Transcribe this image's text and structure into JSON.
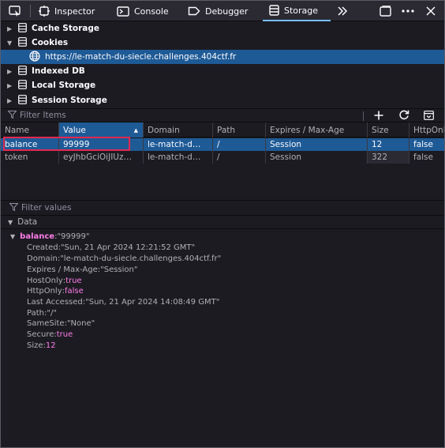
{
  "toolbar": {
    "tabs": [
      {
        "label": "Inspector"
      },
      {
        "label": "Console"
      },
      {
        "label": "Debugger"
      },
      {
        "label": "Storage"
      }
    ]
  },
  "tree": {
    "items": [
      {
        "label": "Cache Storage"
      },
      {
        "label": "Cookies"
      },
      {
        "label": "https://le-match-du-siecle.challenges.404ctf.fr"
      },
      {
        "label": "Indexed DB"
      },
      {
        "label": "Local Storage"
      },
      {
        "label": "Session Storage"
      }
    ]
  },
  "filter_items": {
    "placeholder": "Filter Items"
  },
  "table": {
    "columns": [
      "Name",
      "Value",
      "Domain",
      "Path",
      "Expires / Max-Age",
      "Size",
      "HttpOnly"
    ],
    "rows": [
      {
        "name": "balance",
        "value": "99999",
        "domain": "le-match-d…",
        "path": "/",
        "expires": "Session",
        "size": "12",
        "httponly": "false"
      },
      {
        "name": "token",
        "value": "eyJhbGciOiJIUz…",
        "domain": "le-match-d…",
        "path": "/",
        "expires": "Session",
        "size": "322",
        "httponly": "false"
      }
    ]
  },
  "filter_values": {
    "placeholder": "Filter values"
  },
  "data_panel": {
    "heading": "Data",
    "root_key": "balance",
    "root_value": "\"99999\"",
    "props": [
      {
        "key": "Created",
        "value": "\"Sun, 21 Apr 2024 12:21:52 GMT\"",
        "kind": "s"
      },
      {
        "key": "Domain",
        "value": "\"le-match-du-siecle.challenges.404ctf.fr\"",
        "kind": "s"
      },
      {
        "key": "Expires / Max-Age",
        "value": "\"Session\"",
        "kind": "s"
      },
      {
        "key": "HostOnly",
        "value": "true",
        "kind": "bool"
      },
      {
        "key": "HttpOnly",
        "value": "false",
        "kind": "bool"
      },
      {
        "key": "Last Accessed",
        "value": "\"Sun, 21 Apr 2024 14:08:49 GMT\"",
        "kind": "s"
      },
      {
        "key": "Path",
        "value": "\"/\"",
        "kind": "s"
      },
      {
        "key": "SameSite",
        "value": "\"None\"",
        "kind": "s"
      },
      {
        "key": "Secure",
        "value": "true",
        "kind": "bool"
      },
      {
        "key": "Size",
        "value": "12",
        "kind": "num"
      }
    ]
  },
  "colors": {
    "accent": "#75bfff",
    "selection": "#1e5a96",
    "highlight_box": "#e22850",
    "keyword": "#ff7de9"
  }
}
